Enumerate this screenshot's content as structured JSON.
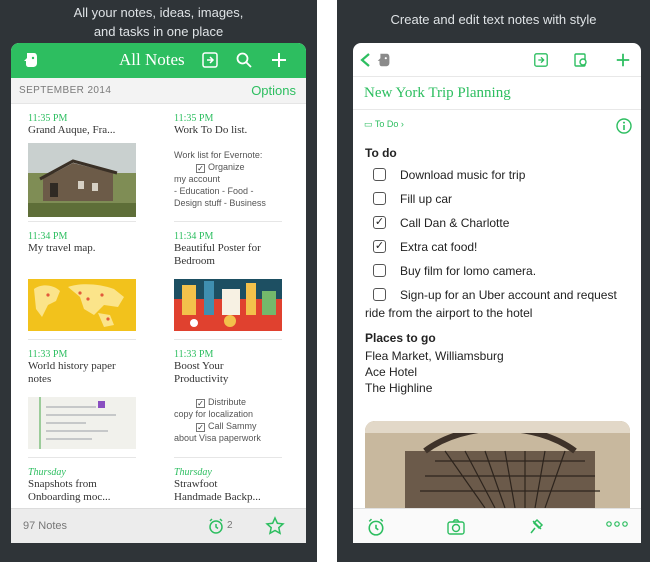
{
  "left": {
    "caption_line1": "All your notes, ideas, images,",
    "caption_line2": "and tasks in one place",
    "header": {
      "title": "All Notes"
    },
    "subbar": {
      "month": "SEPTEMBER 2014",
      "options": "Options"
    },
    "notes": [
      {
        "time": "11:35 PM",
        "title": "Grand Auque, Fra..."
      },
      {
        "time": "11:35 PM",
        "title": "Work To Do list.",
        "body1": "Work list for Evernote:",
        "body2": "Organize",
        "body3": "my account",
        "body4": "- Education - Food -",
        "body5": "Design stuff - Business"
      },
      {
        "time": "11:34 PM",
        "title": "My travel map."
      },
      {
        "time": "11:34 PM",
        "title1": "Beautiful  Poster for",
        "title2": "Bedroom"
      },
      {
        "time": "11:33 PM",
        "title1": "World history paper",
        "title2": "notes"
      },
      {
        "time": "11:33 PM",
        "title1": "Boost Your",
        "title2": "Productivity",
        "body1": "Distribute",
        "body2": "copy for localization",
        "body3": "Call Sammy",
        "body4": "about Visa paperwork"
      },
      {
        "time": "Thursday",
        "title1": "Snapshots from",
        "title2": "Onboarding moc..."
      },
      {
        "time": "Thursday",
        "title1": "Strawfoot",
        "title2": "Handmade Backp..."
      }
    ],
    "footer": {
      "count": "97 Notes",
      "reminders": "2"
    }
  },
  "right": {
    "caption": "Create and edit text notes with style",
    "note_title": "New York Trip Planning",
    "notebook": "To Do",
    "todo_heading": "To do",
    "todos": [
      {
        "text": "Download music for trip",
        "checked": false
      },
      {
        "text": "Fill up car",
        "checked": false
      },
      {
        "text": "Call Dan & Charlotte",
        "checked": true
      },
      {
        "text": "Extra cat food!",
        "checked": true
      },
      {
        "text": "Buy film for lomo camera.",
        "checked": false
      },
      {
        "text": "Sign-up for an Uber account and request ride from the airport to the hotel",
        "checked": false
      }
    ],
    "places_heading": "Places to go",
    "places": [
      "Flea Market, Williamsburg",
      "Ace Hotel",
      "The Highline"
    ]
  },
  "colors": {
    "accent": "#2dbe60",
    "frame": "#2f3438"
  },
  "icons": [
    "evernote-elephant-icon",
    "share-icon",
    "search-icon",
    "plus-icon",
    "back-chevron-icon",
    "annotate-icon",
    "reminder-clock-icon",
    "star-icon",
    "camera-icon",
    "attach-icon",
    "more-icon",
    "info-icon",
    "notebook-icon"
  ]
}
